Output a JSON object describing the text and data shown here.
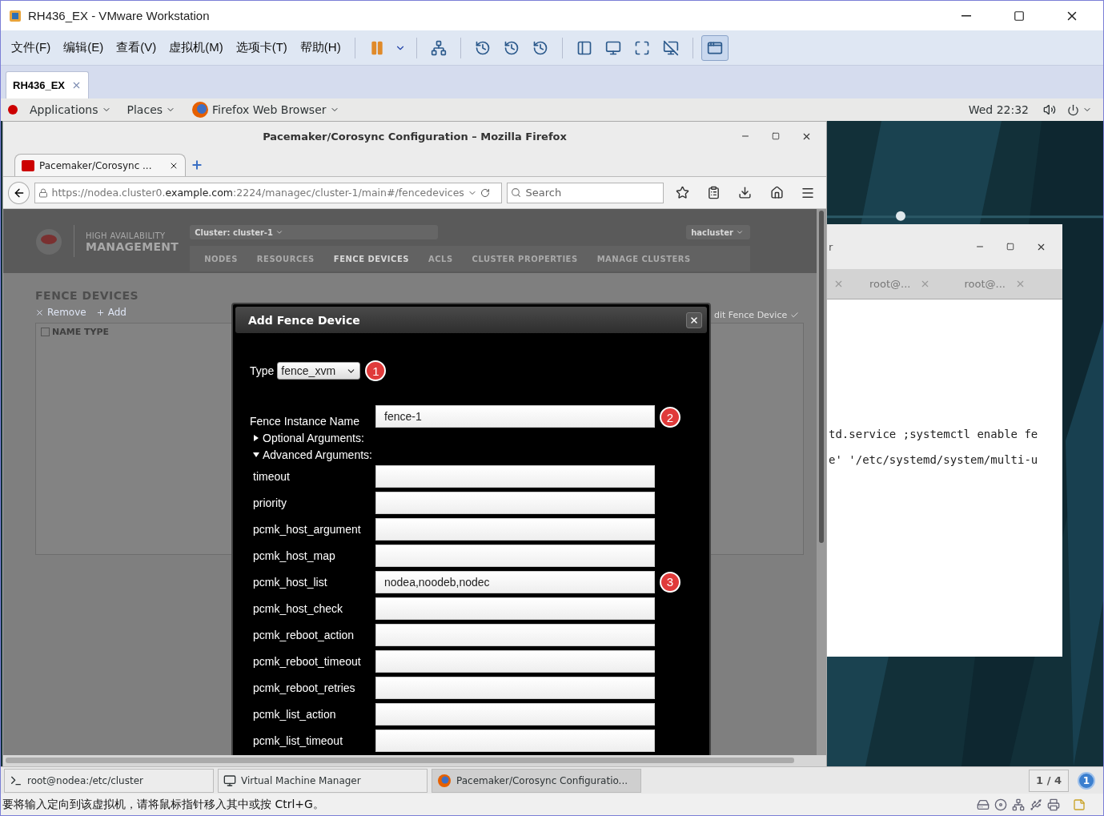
{
  "host_window": {
    "title": "RH436_EX - VMware Workstation"
  },
  "menu": [
    "文件(F)",
    "编辑(E)",
    "查看(V)",
    "虚拟机(M)",
    "选项卡(T)",
    "帮助(H)"
  ],
  "vm_tabs": [
    {
      "label": "RH436_EX",
      "selected": true
    }
  ],
  "gnome_bar": {
    "applications": "Applications",
    "places": "Places",
    "app": "Firefox Web Browser",
    "clock": "Wed 22:32"
  },
  "firefox": {
    "title": "Pacemaker/Corosync Configuration – Mozilla Firefox",
    "tabs": [
      {
        "label": "Pacemaker/Corosync ...",
        "selected": true
      }
    ],
    "url": {
      "prefix": "https://nodea.cluster0.",
      "host": "example.com",
      "suffix": ":2224/managec/cluster-1/main#/fencedevices"
    },
    "search_placeholder": "Search"
  },
  "pcs": {
    "brand_top": "HIGH AVAILABILITY",
    "brand_bottom": "MANAGEMENT",
    "cluster": "Cluster: cluster-1",
    "user": "hacluster",
    "nav": [
      {
        "label": "NODES",
        "selected": false
      },
      {
        "label": "RESOURCES",
        "selected": false
      },
      {
        "label": "FENCE DEVICES",
        "selected": true
      },
      {
        "label": "ACLS",
        "selected": false
      },
      {
        "label": "CLUSTER PROPERTIES",
        "selected": false
      },
      {
        "label": "MANAGE CLUSTERS",
        "selected": false
      }
    ],
    "heading": "FENCE DEVICES",
    "actions": [
      "Remove",
      "Add"
    ],
    "table_header": "NAME TYPE",
    "side_label": "dit Fence Device"
  },
  "dialog": {
    "title": "Add Fence Device",
    "type_label": "Type",
    "type_value": "fence_xvm",
    "type_badge": "1",
    "name_label": "Fence Instance Name",
    "name_value": "fence-1",
    "name_badge": "2",
    "sections": [
      {
        "label": "Optional Arguments:",
        "expanded": false
      },
      {
        "label": "Advanced Arguments:",
        "expanded": true
      }
    ],
    "arguments": [
      {
        "label": "timeout"
      },
      {
        "label": "priority"
      },
      {
        "label": "pcmk_host_argument"
      },
      {
        "label": "pcmk_host_map"
      },
      {
        "label": "pcmk_host_list",
        "value": "nodea,noodeb,nodec",
        "badge": "3"
      },
      {
        "label": "pcmk_host_check"
      },
      {
        "label": "pcmk_reboot_action"
      },
      {
        "label": "pcmk_reboot_timeout"
      },
      {
        "label": "pcmk_reboot_retries"
      },
      {
        "label": "pcmk_list_action"
      },
      {
        "label": "pcmk_list_timeout"
      }
    ]
  },
  "terminal": {
    "title": "r",
    "tabs": [
      "root@...",
      "root@..."
    ],
    "lines": [
      "td.service ;systemctl enable fe",
      "e' '/etc/systemd/system/multi-u"
    ]
  },
  "taskbar": {
    "items": [
      {
        "label": "root@nodea:/etc/cluster",
        "selected": false,
        "kind": "terminal"
      },
      {
        "label": "Virtual Machine Manager",
        "selected": false,
        "kind": "vmm"
      },
      {
        "label": "Pacemaker/Corosync Configuratio...",
        "selected": true,
        "kind": "browser"
      }
    ],
    "workspace": "1 / 4",
    "notifications": "1"
  },
  "status_bar": "要将输入定向到该虚拟机，请将鼠标指针移入其中或按 Ctrl+G。"
}
